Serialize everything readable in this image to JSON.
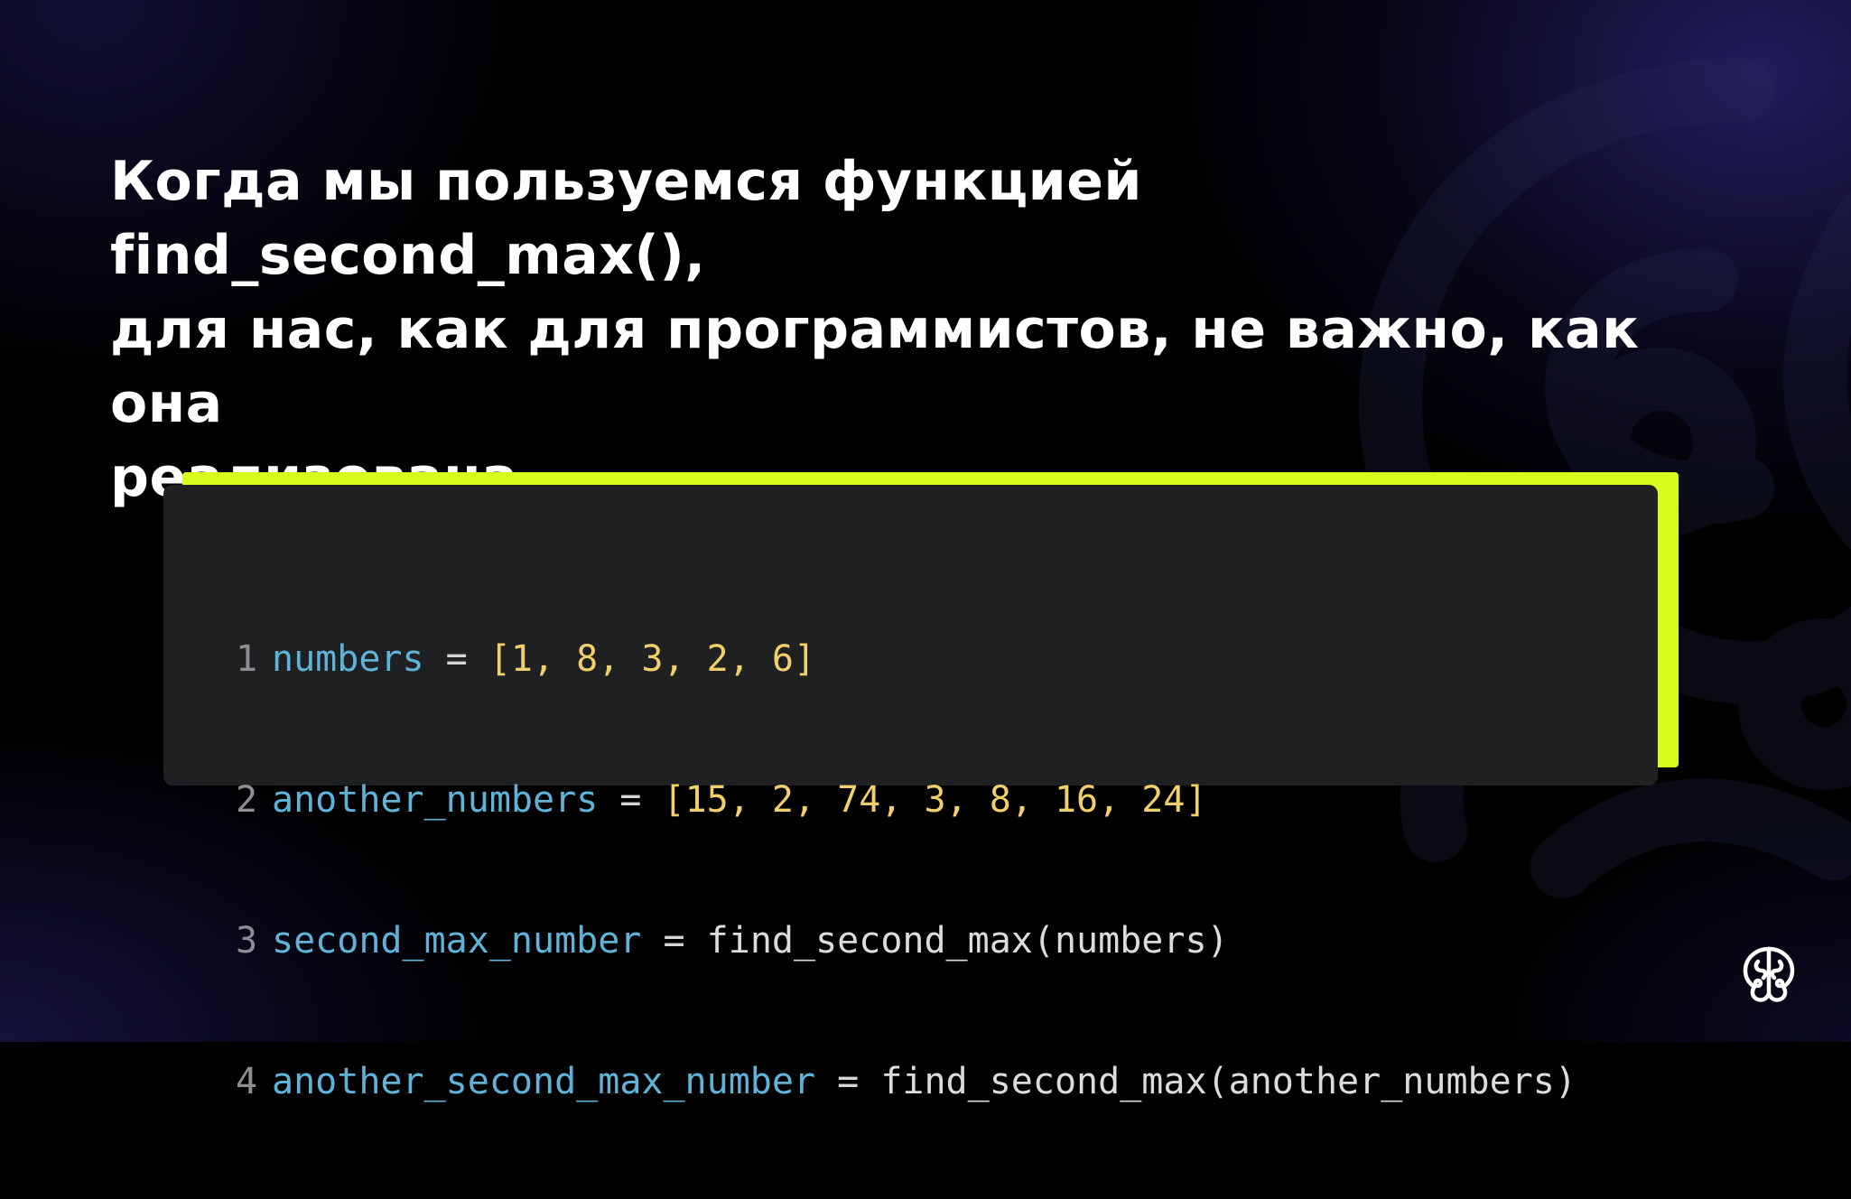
{
  "slide": {
    "headline_lines": [
      "Когда мы пользуемся функцией find_second_max(),",
      "для нас, как для программистов, не важно, как она",
      "реализована."
    ]
  },
  "code": {
    "lines": [
      {
        "number": "1",
        "var": "numbers",
        "op": " = ",
        "rest": "[1, 8, 3, 2, 6]",
        "rest_kind": "lit"
      },
      {
        "number": "2",
        "var": "another_numbers",
        "op": " = ",
        "rest": "[15, 2, 74, 3, 8, 16, 24]",
        "rest_kind": "lit"
      },
      {
        "number": "3",
        "var": "second_max_number",
        "op": " = ",
        "rest": "find_second_max(numbers)",
        "rest_kind": "fn"
      },
      {
        "number": "4",
        "var": "another_second_max_number",
        "op": " = ",
        "rest": "find_second_max(another_numbers)",
        "rest_kind": "fn"
      }
    ]
  },
  "colors": {
    "accent": "#d7fb1e",
    "code_background": "#1f2022",
    "variable": "#5fb3d9",
    "literal": "#f1cf6a",
    "line_number": "#8d8f93",
    "background": "#000000"
  },
  "icons": {
    "background_logo": "brain-logo-icon",
    "corner_logo": "brain-logo-icon"
  }
}
